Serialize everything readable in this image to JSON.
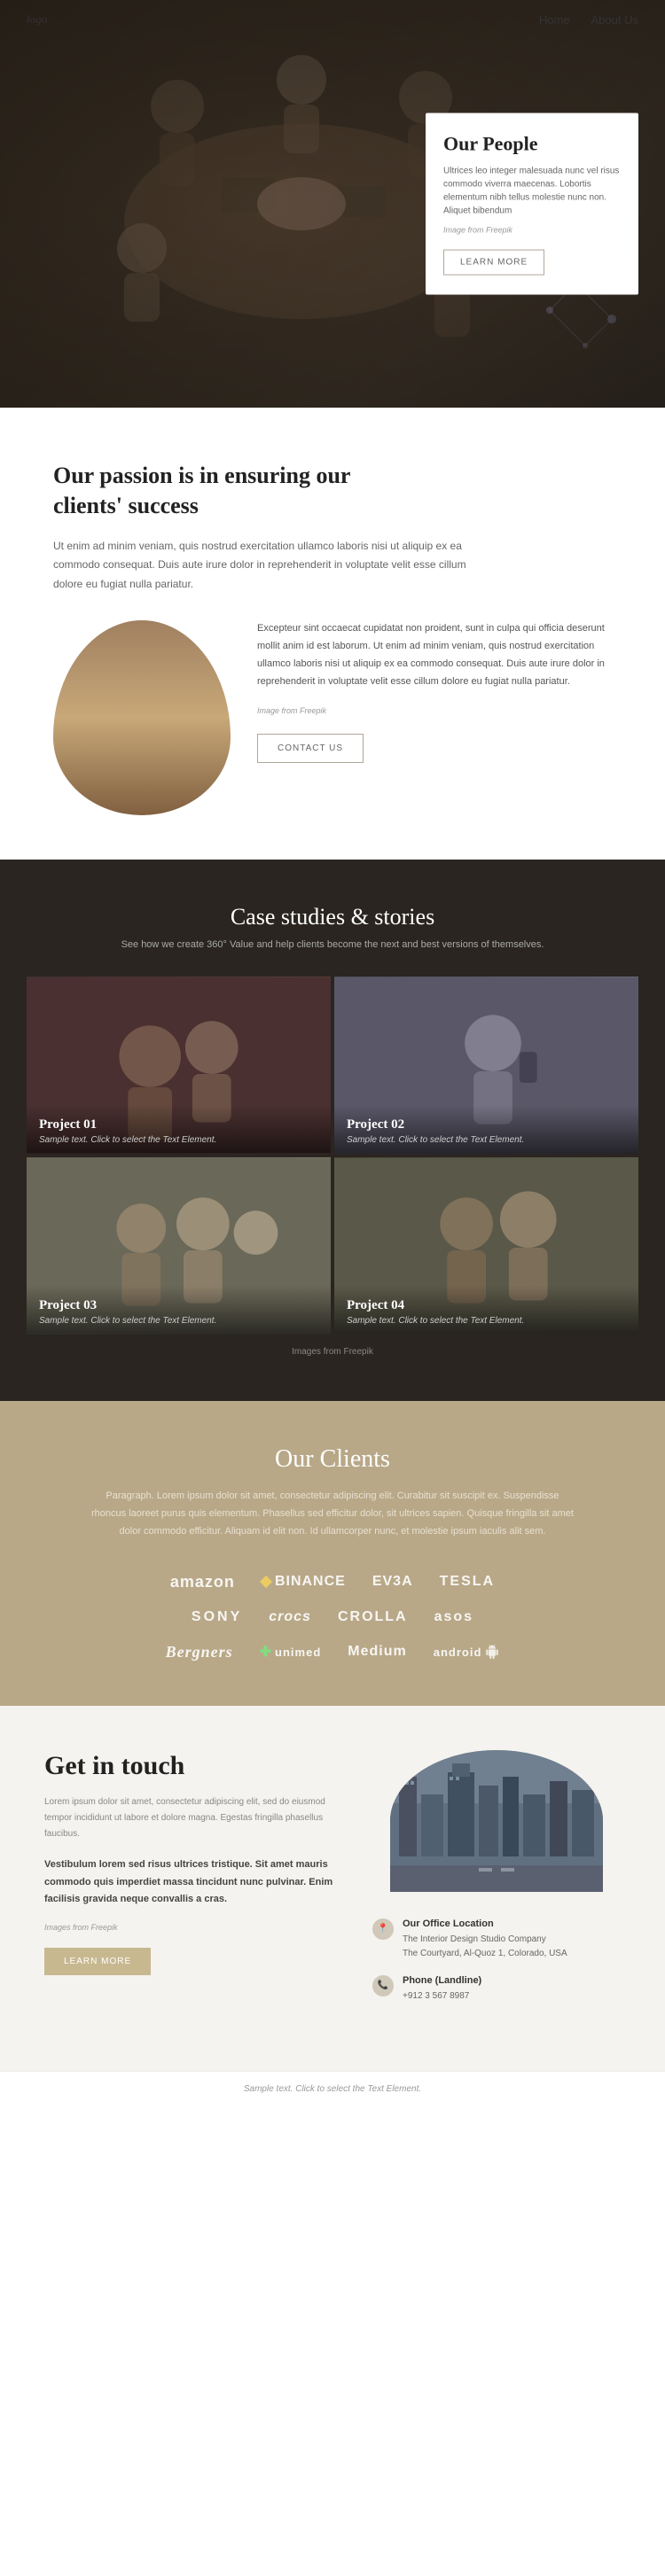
{
  "nav": {
    "logo": "logo",
    "links": [
      "Home",
      "About Us"
    ]
  },
  "hero": {
    "card": {
      "title": "Our People",
      "body": "Ultrices leo integer malesuada nunc vel risus commodo viverra maecenas. Lobortis elementum nibh tellus molestie nunc non. Aliquet bibendum",
      "image_caption": "Image from Freepik",
      "learn_more": "LEARN MORE"
    }
  },
  "passion": {
    "heading": "Our passion is in ensuring our clients' success",
    "intro": "Ut enim ad minim veniam, quis nostrud exercitation ullamco laboris nisi ut aliquip ex ea commodo consequat. Duis aute irure dolor in reprehenderit in voluptate velit esse cillum dolore eu fugiat nulla pariatur.",
    "body": "Excepteur sint occaecat cupidatat non proident, sunt in culpa qui officia deserunt mollit anim id est laborum. Ut enim ad minim veniam, quis nostrud exercitation ullamco laboris nisi ut aliquip ex ea commodo consequat. Duis aute irure dolor in reprehenderit in voluptate velit esse cillum dolore eu fugiat nulla pariatur.",
    "image_caption": "Image from Freepik",
    "contact_us": "CONTACT US"
  },
  "case_studies": {
    "heading": "Case studies & stories",
    "subtitle": "See how we create 360° Value and help clients become the next and best versions of themselves.",
    "projects": [
      {
        "number": "Project 01",
        "caption": "Sample text. Click to select the Text Element."
      },
      {
        "number": "Project 02",
        "caption": "Sample text. Click to select the Text Element."
      },
      {
        "number": "Project 03",
        "caption": "Sample text. Click to select the Text Element."
      },
      {
        "number": "Project 04",
        "caption": "Sample text. Click to select the Text Element."
      }
    ],
    "image_caption": "Images from Freepik"
  },
  "clients": {
    "heading": "Our Clients",
    "desc": "Paragraph. Lorem ipsum dolor sit amet, consectetur adipiscing elit. Curabitur sit suscipit ex. Suspendisse rhoncus laoreet purus quis elementum. Phasellus sed efficitur dolor, sit ultrices sapien. Quisque fringilla sit amet dolor commodo efficitur. Aliquam id elit non. Id ullamcorper nunc, et molestie ipsum iaculis alit sem.",
    "logos_row1": [
      "amazon",
      "◈ BINANCE",
      "EV3A",
      "TESLA"
    ],
    "logos_row2": [
      "SONY",
      "crocs",
      "CROLLA",
      "asos"
    ],
    "logos_row3": [
      "Bergners",
      "unimed",
      "Medium",
      "android"
    ]
  },
  "contact": {
    "heading": "Get in touch",
    "desc": "Lorem ipsum dolor sit amet, consectetur adipiscing elit, sed do eiusmod tempor incididunt ut labore et dolore magna. Egestas fringilla phasellus faucibus.",
    "highlight": "Vestibulum lorem sed risus ultrices tristique. Sit amet mauris commodo quis imperdiet massa tincidunt nunc pulvinar. Enim facilisis gravida neque convallis a cras.",
    "image_caption": "Images from Freepik",
    "learn_more": "LEARN MORE",
    "office": {
      "label": "Our Office Location",
      "company": "The Interior Design Studio Company",
      "address": "The Courtyard, Al-Quoz 1, Colorado, USA"
    },
    "phone": {
      "label": "Phone (Landline)",
      "number": "+912 3 567 8987"
    }
  },
  "footer": {
    "text": "Sample text. Click to select the Text Element."
  }
}
